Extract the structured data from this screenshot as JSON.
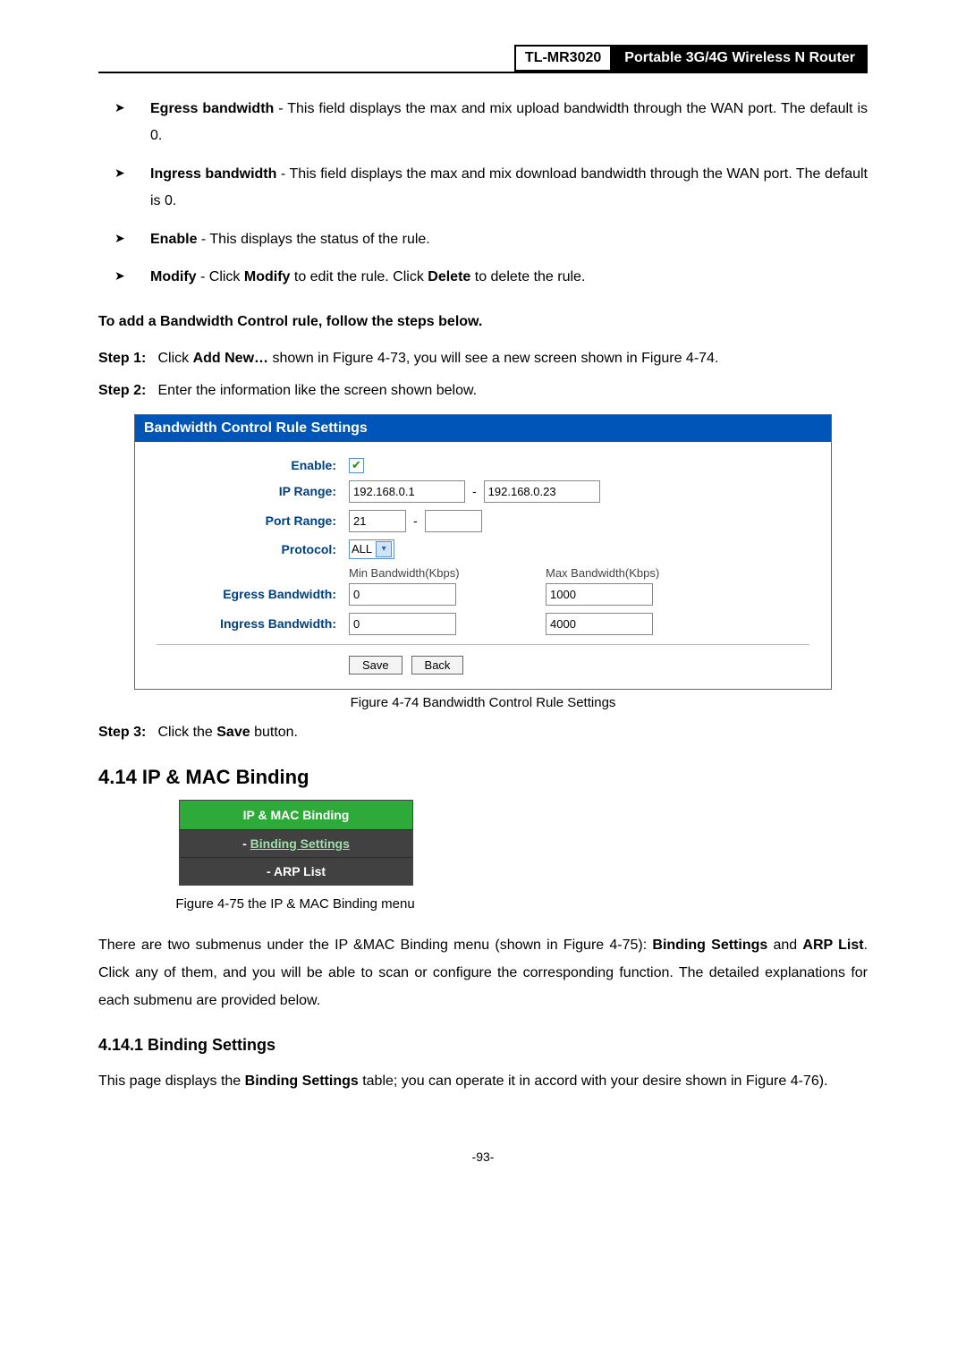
{
  "header": {
    "model": "TL-MR3020",
    "desc": "Portable 3G/4G Wireless N Router"
  },
  "bullets": {
    "egress_label": "Egress bandwidth",
    "egress_text": " - This field displays the max and mix upload bandwidth through the WAN port. The default is 0.",
    "ingress_label": "Ingress bandwidth",
    "ingress_text": " - This field displays the max and mix download bandwidth through the WAN port. The default is 0.",
    "enable_label": "Enable",
    "enable_text": " - This displays the status of the rule.",
    "modify_label": "Modify",
    "modify_text_a": " - Click ",
    "modify_text_b": "Modify",
    "modify_text_c": " to edit the rule. Click ",
    "modify_text_d": "Delete",
    "modify_text_e": " to delete the rule."
  },
  "intro": "To add a Bandwidth Control rule, follow the steps below.",
  "steps": {
    "s1_label": "Step 1:",
    "s1_a": "Click ",
    "s1_b": "Add New…",
    "s1_c": " shown in Figure 4-73, you will see a new screen shown in Figure 4-74.",
    "s2_label": "Step 2:",
    "s2": "Enter the information like the screen shown below.",
    "s3_label": "Step 3:",
    "s3_a": "Click the ",
    "s3_b": "Save",
    "s3_c": " button."
  },
  "panel": {
    "title": "Bandwidth Control Rule Settings",
    "labels": {
      "enable": "Enable:",
      "ip_range": "IP Range:",
      "port_range": "Port Range:",
      "protocol": "Protocol:",
      "egress": "Egress Bandwidth:",
      "ingress": "Ingress Bandwidth:"
    },
    "values": {
      "ip_from": "192.168.0.1",
      "ip_to": "192.168.0.23",
      "port_from": "21",
      "port_to": "",
      "protocol": "ALL",
      "egress_min": "0",
      "egress_max": "1000",
      "ingress_min": "0",
      "ingress_max": "4000"
    },
    "col_min": "Min Bandwidth(Kbps)",
    "col_max": "Max Bandwidth(Kbps)",
    "btn_save": "Save",
    "btn_back": "Back"
  },
  "fig74": "Figure 4-74 Bandwidth Control Rule Settings",
  "section": {
    "h2": "4.14 IP & MAC Binding",
    "menu_head": "IP & MAC Binding",
    "menu_item1_prefix": "- ",
    "menu_item1": "Binding Settings",
    "menu_item2": "- ARP List",
    "fig75": "Figure 4-75 the IP & MAC Binding menu",
    "para_a": "There are two submenus under the IP &MAC Binding menu (shown in Figure 4-75): ",
    "para_b": "Binding Settings",
    "para_c": " and ",
    "para_d": "ARP List",
    "para_e": ". Click any of them, and you will be able to scan or configure the corresponding function. The detailed explanations for each submenu are provided below.",
    "h3": "4.14.1  Binding Settings",
    "para2_a": "This page displays the ",
    "para2_b": "Binding Settings",
    "para2_c": " table; you can operate it in accord with your desire shown in Figure 4-76)."
  },
  "page_num": "-93-"
}
